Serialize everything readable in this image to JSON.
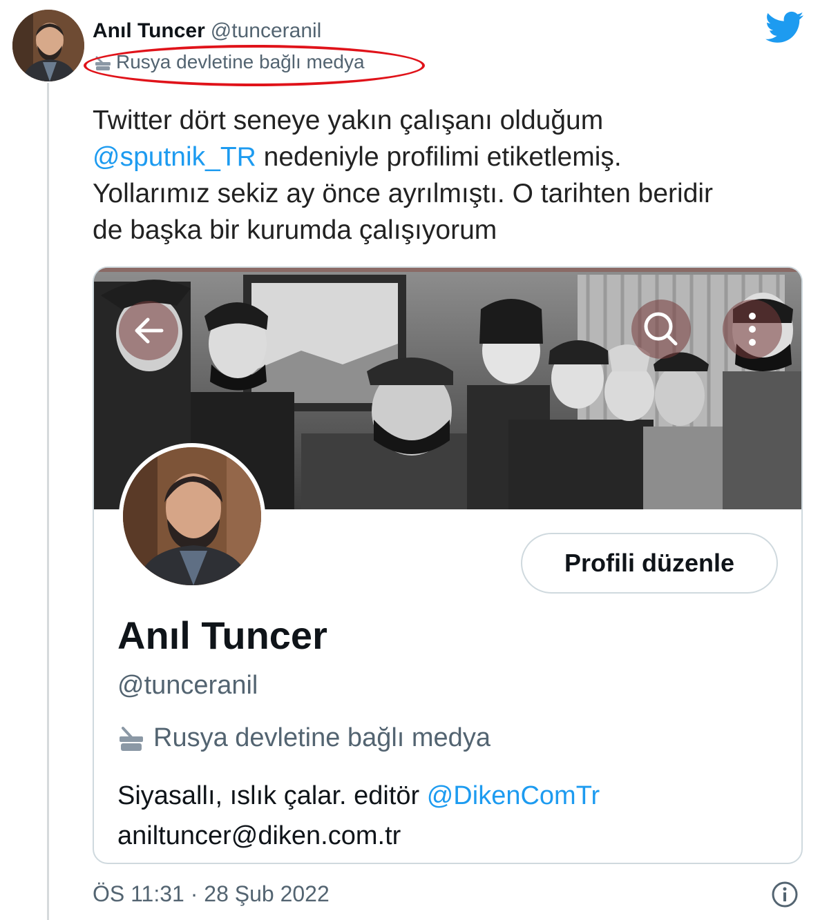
{
  "tweet": {
    "author_name": "Anıl Tuncer",
    "author_handle": "@tunceranil",
    "author_label": "Rusya devletine bağlı medya",
    "text": {
      "line1": "Twitter dört seneye yakın çalışanı olduğum",
      "mention": "@sputnik_TR",
      "line2_rest": " nedeniyle profilimi etiketlemiş.",
      "line3": "Yollarımız sekiz ay önce ayrılmıştı. O tarihten beridir",
      "line4": "de başka bir kurumda çalışıyorum"
    },
    "timestamp": "ÖS 11:31 · 28 Şub 2022"
  },
  "profile_card": {
    "edit_button_label": "Profili düzenle",
    "name": "Anıl Tuncer",
    "handle": "@tunceranil",
    "label": "Rusya devletine bağlı medya",
    "bio_text": "Siyasallı, ıslık çalar. editör ",
    "bio_mention": "@DikenComTr",
    "bio_email": "aniltuncer@diken.com.tr"
  },
  "colors": {
    "accent": "#1d9bf0",
    "highlight_oval": "#e0131a",
    "secondary_text": "#536471"
  },
  "icons": [
    "twitter-bird-icon",
    "state-media-icon",
    "back-arrow-icon",
    "search-icon",
    "more-vertical-icon",
    "info-icon"
  ]
}
